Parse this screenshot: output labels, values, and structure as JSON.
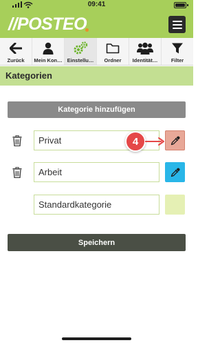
{
  "status_bar": {
    "time": "09:41"
  },
  "header": {
    "logo": "//POSTEO"
  },
  "toolbar": {
    "items": [
      {
        "label": "Zurück",
        "icon": "arrow-left-icon"
      },
      {
        "label": "Mein Kon…",
        "icon": "person-icon"
      },
      {
        "label": "Einstellu…",
        "icon": "gears-icon"
      },
      {
        "label": "Ordner",
        "icon": "folder-icon"
      },
      {
        "label": "Identität…",
        "icon": "people-icon"
      },
      {
        "label": "Filter",
        "icon": "filter-icon"
      }
    ],
    "active_index": 2
  },
  "section": {
    "title": "Kategorien"
  },
  "actions": {
    "add_label": "Kategorie hinzufügen",
    "save_label": "Speichern"
  },
  "categories": [
    {
      "value": "Privat",
      "color": "#e8a898",
      "picker_icon": "eyedropper-icon"
    },
    {
      "value": "Arbeit",
      "color": "#29b6e8",
      "picker_icon": "eyedropper-icon"
    },
    {
      "value": "Standardkategorie",
      "color": "#e5f0b4",
      "picker_icon": ""
    }
  ],
  "annotation": {
    "step_number": "4",
    "badge_color": "#e54848"
  },
  "colors": {
    "brand_green": "#a7cf5a",
    "section_green": "#c3df92",
    "button_grey": "#8a8a8a",
    "save_dark": "#4a4f45"
  }
}
